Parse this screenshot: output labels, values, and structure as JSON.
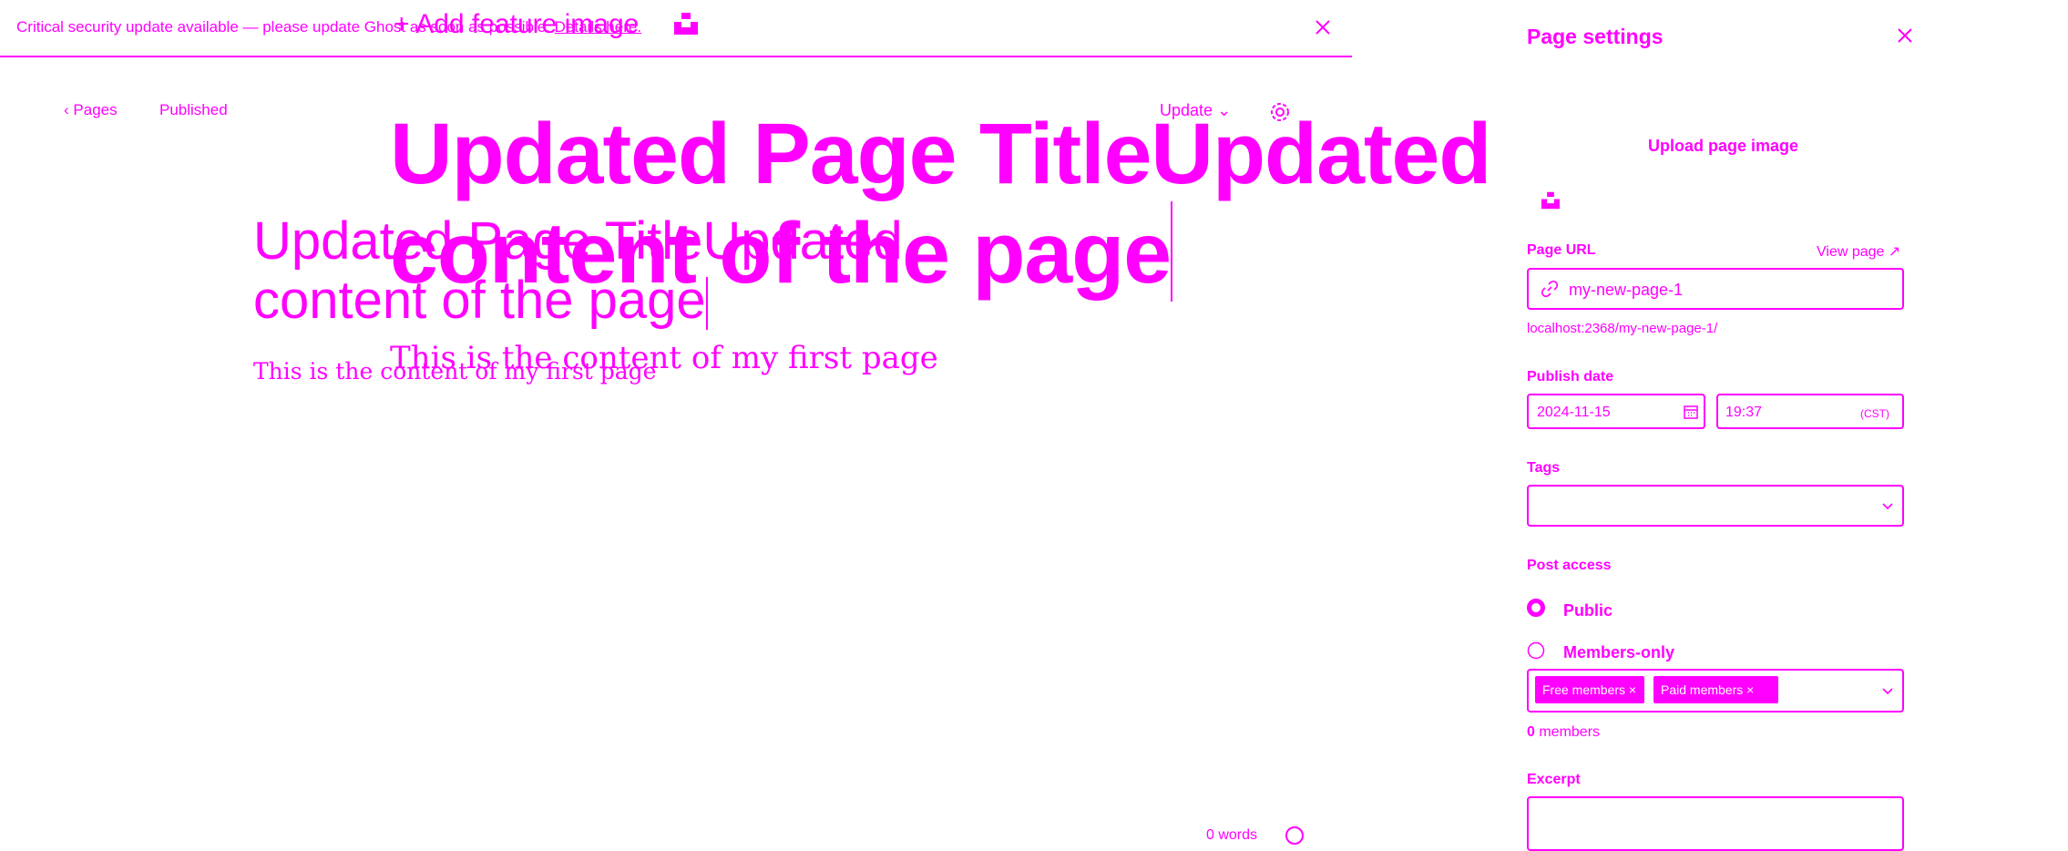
{
  "banner": {
    "message": "Critical security update available — please update Ghost as soon as possible.",
    "link": "Details here."
  },
  "feature_image": {
    "label": "+ Add feature image"
  },
  "nav": {
    "back_label": "Pages",
    "status": "Published",
    "update_label": "Update"
  },
  "editor": {
    "title": "Updated Page TitleUpdated content of the page",
    "body": "This is the content of my first page",
    "word_count": "0 words"
  },
  "settings": {
    "title": "Page settings",
    "upload_image": "Upload page image",
    "page_url_label": "Page URL",
    "view_page": "View page",
    "slug": "my-new-page-1",
    "url_hint": "localhost:2368/my-new-page-1/",
    "publish_date_label": "Publish date",
    "date": "2024-11-15",
    "time": "19:37",
    "timezone": "(CST)",
    "tags_label": "Tags",
    "tags_value": "",
    "access_label": "Post access",
    "access_options": [
      {
        "label": "Public",
        "selected": true
      },
      {
        "label": "Members-only",
        "selected": false
      }
    ],
    "tiers": [
      "Free members",
      "Paid members"
    ],
    "members_count": "0",
    "members_suffix": " members",
    "excerpt_label": "Excerpt",
    "excerpt_value": ""
  },
  "colors": {
    "accent": "#ff00ff",
    "background": "#ffffff"
  }
}
